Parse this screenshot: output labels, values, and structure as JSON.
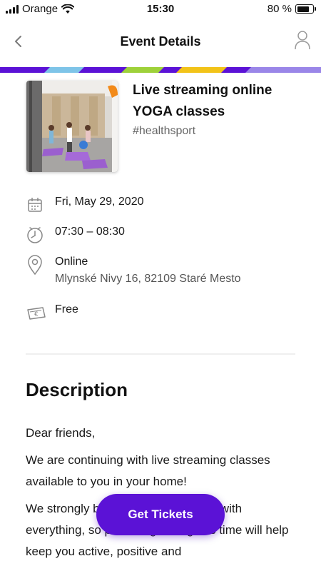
{
  "status_bar": {
    "carrier": "Orange",
    "time": "15:30",
    "battery_percent": "80 %",
    "battery_level": 0.8
  },
  "nav": {
    "title": "Event Details",
    "back_icon": "chevron-left-icon",
    "profile_icon": "user-icon"
  },
  "event": {
    "title": "Live streaming online YOGA classes",
    "tag": "#healthsport",
    "date": "Fri, May 29, 2020",
    "time": "07:30 – 08:30",
    "location_name": "Online",
    "location_address": "Mlynské Nivy 16, 82109 Staré Mesto",
    "price": "Free"
  },
  "description": {
    "heading": "Description",
    "paragraphs": [
      "Dear friends,",
      "We are continuing with live streaming classes available to you in your home!",
      "We strongly believe that yoga helps with everything, so practicing during this time will help keep you active, positive and"
    ]
  },
  "cta": {
    "label": "Get Tickets"
  },
  "colors": {
    "brand_purple": "#5b12d6",
    "stripe": [
      "#5b12d6",
      "#7ec4e8",
      "#5b12d6",
      "#9ed13a",
      "#f2c318",
      "#5b12d6",
      "#9a86e8"
    ]
  }
}
